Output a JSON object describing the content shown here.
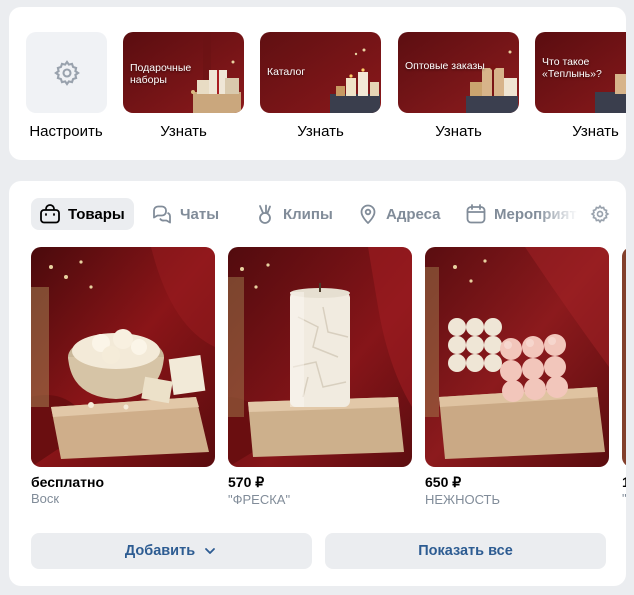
{
  "top_strip": {
    "setup_label": "Настроить",
    "items": [
      {
        "thumb_text": "Подарочные наборы",
        "label": "Узнать"
      },
      {
        "thumb_text": "Каталог",
        "label": "Узнать"
      },
      {
        "thumb_text": "Оптовые заказы",
        "label": "Узнать"
      },
      {
        "thumb_text": "Что такое «Теплынь»?",
        "label": "Узнать"
      }
    ]
  },
  "tabs": [
    {
      "label": "Товары",
      "icon": "bag-icon",
      "active": true
    },
    {
      "label": "Чаты",
      "icon": "chats-icon"
    },
    {
      "label": "Клипы",
      "icon": "clips-icon"
    },
    {
      "label": "Адреса",
      "icon": "map-pin-icon"
    },
    {
      "label": "Мероприятия",
      "icon": "calendar-icon"
    }
  ],
  "products": [
    {
      "price": "бесплатно",
      "name": "Воск"
    },
    {
      "price": "570 ₽",
      "name": "\"ФРЕСКА\""
    },
    {
      "price": "650 ₽",
      "name": "НЕЖНОСТЬ"
    },
    {
      "price": "1",
      "name": "\""
    }
  ],
  "buttons": {
    "add_label": "Добавить",
    "show_all_label": "Показать все"
  },
  "colors": {
    "accent": "#2d5c92",
    "secondary_text": "#818c99",
    "background": "#ebedf0",
    "backdrop_red": "#7a1414"
  }
}
